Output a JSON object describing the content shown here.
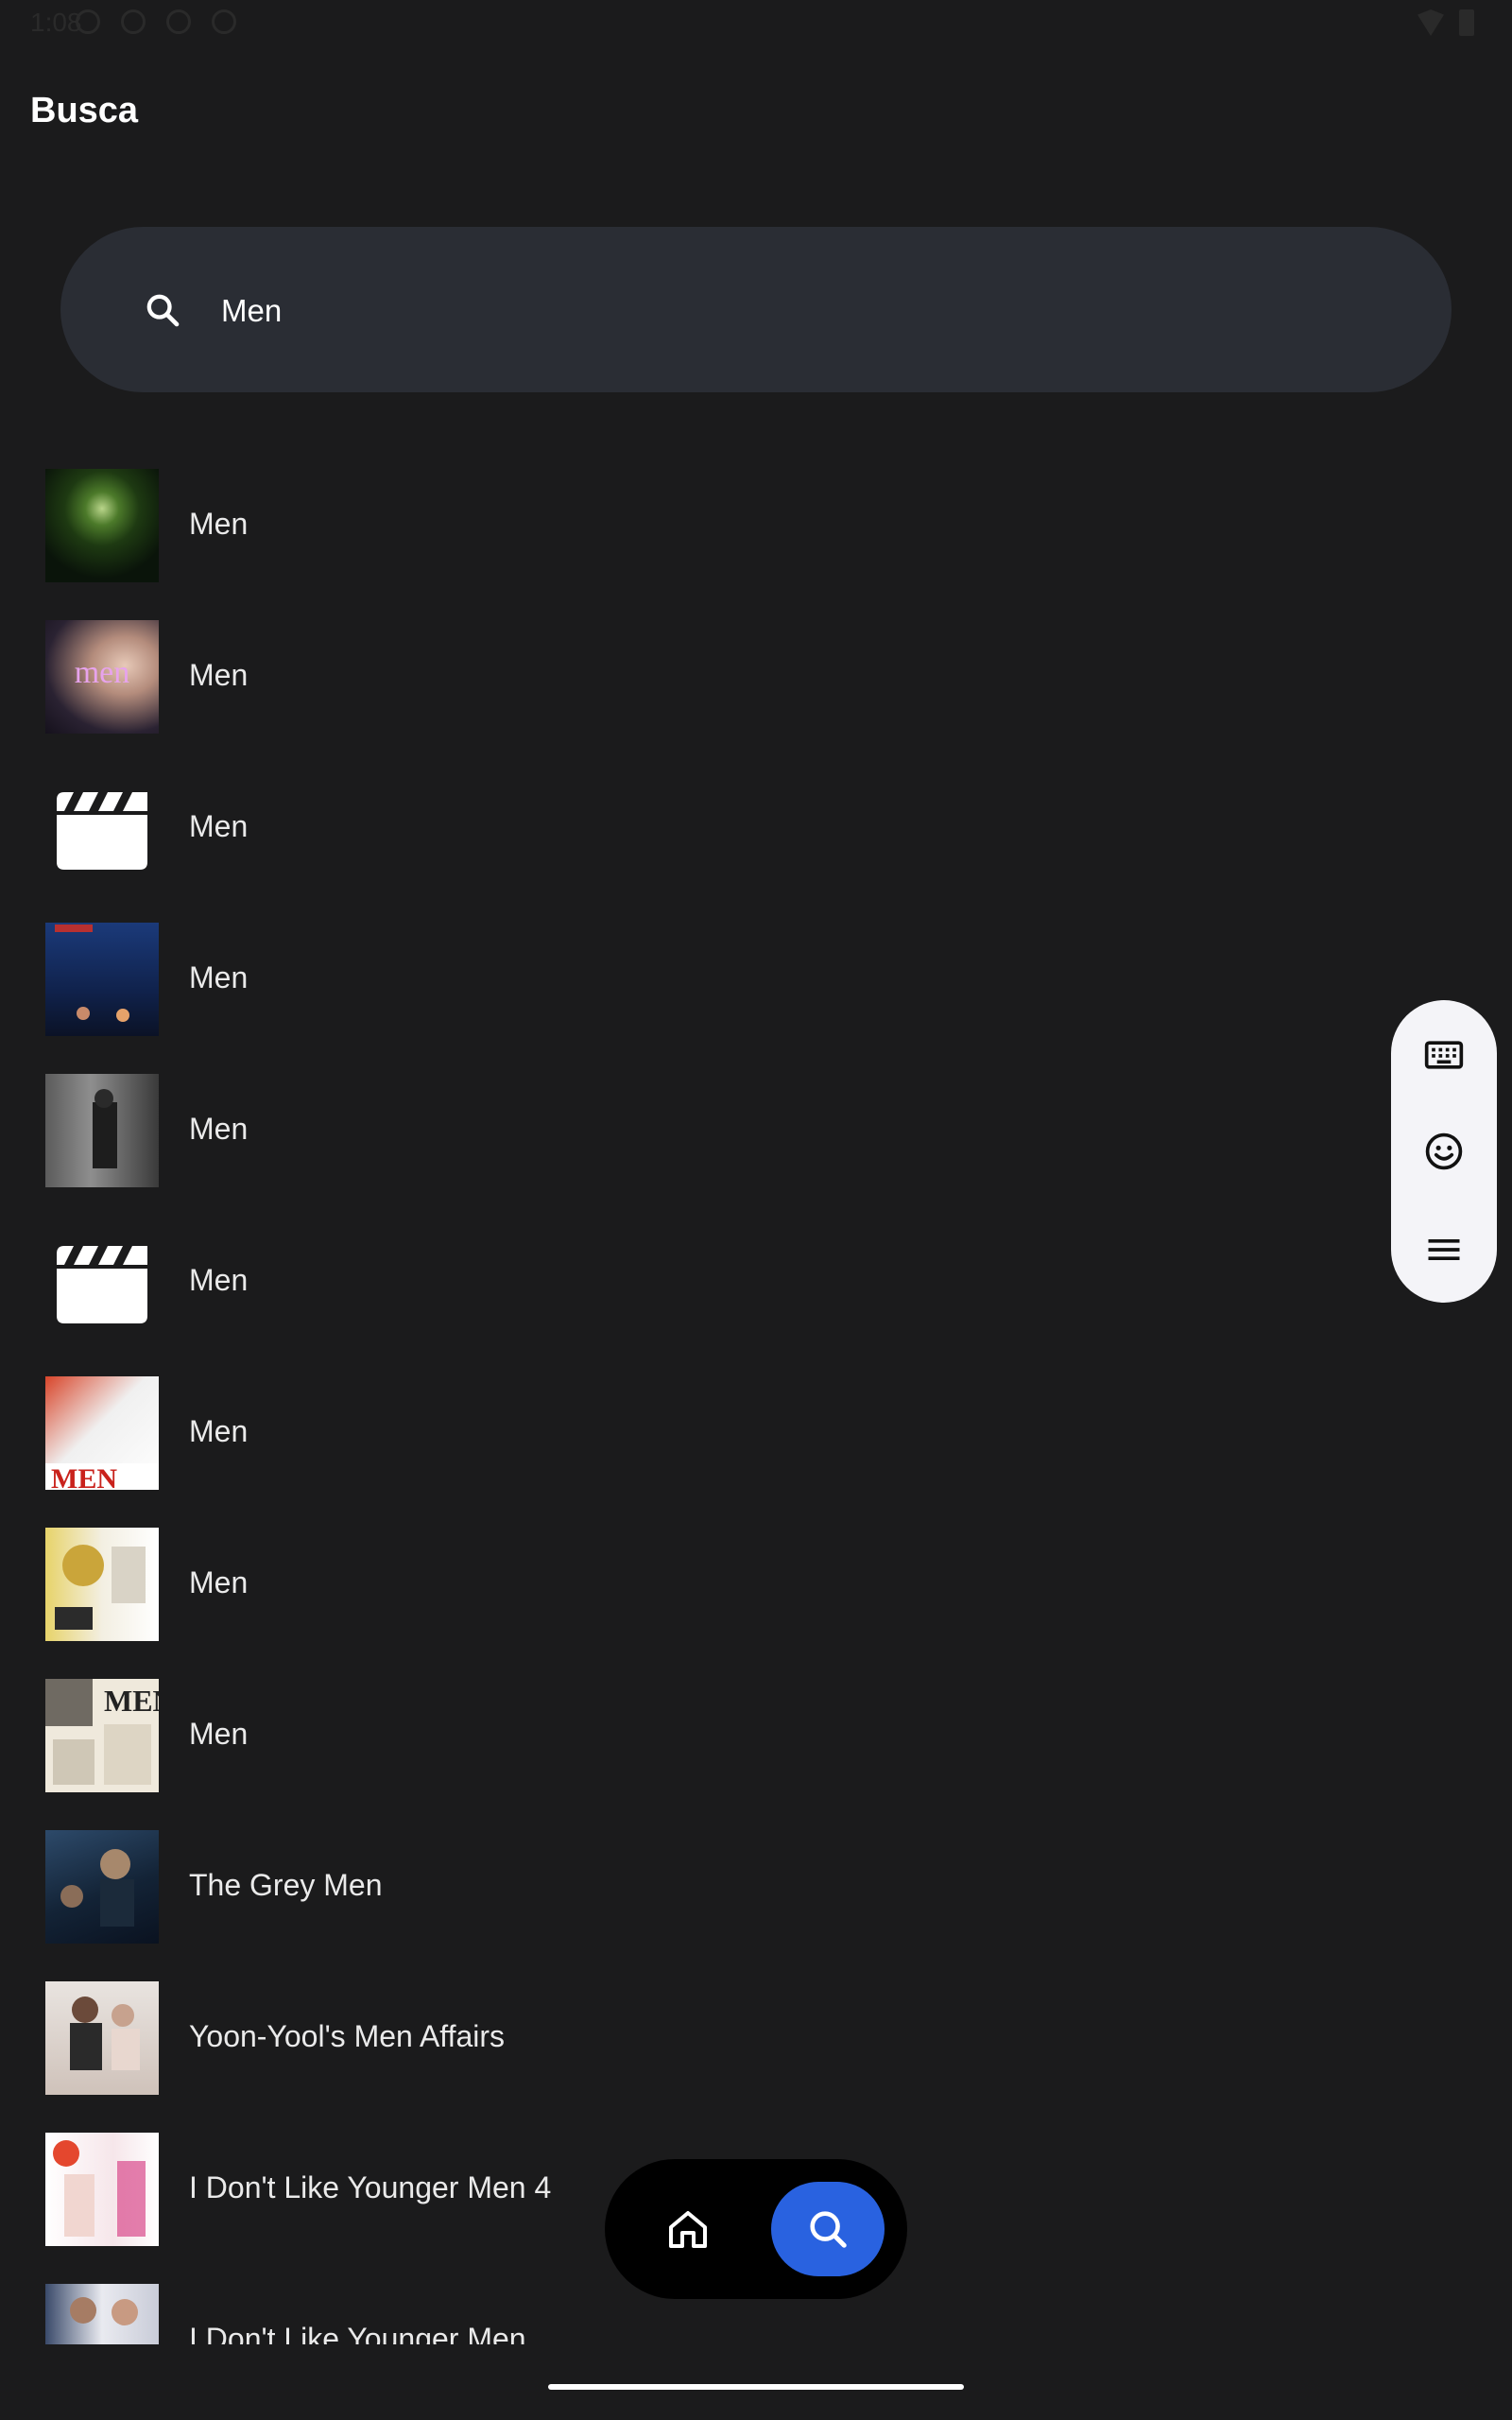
{
  "status": {
    "time": "1:08"
  },
  "header": {
    "title": "Busca"
  },
  "search": {
    "value": "Men",
    "placeholder": ""
  },
  "results": [
    {
      "title": "Men",
      "thumb": "forest-tunnel-poster"
    },
    {
      "title": "Men",
      "thumb": "mannequin-men-poster"
    },
    {
      "title": "Men",
      "thumb": "clapperboard-placeholder"
    },
    {
      "title": "Men",
      "thumb": "blue-night-poster"
    },
    {
      "title": "Men",
      "thumb": "grey-street-poster"
    },
    {
      "title": "Men",
      "thumb": "clapperboard-placeholder"
    },
    {
      "title": "Men",
      "thumb": "red-men-poster"
    },
    {
      "title": "Men",
      "thumb": "yellow-art-poster"
    },
    {
      "title": "Men",
      "thumb": "newspaper-men-poster"
    },
    {
      "title": "The Grey Men",
      "thumb": "dark-action-poster"
    },
    {
      "title": "Yoon-Yool's Men Affairs",
      "thumb": "korean-drama-poster"
    },
    {
      "title": "I Don't Like Younger Men 4",
      "thumb": "korean-pink-poster"
    },
    {
      "title": "I Don't Like Younger Men",
      "thumb": "korean-couple-poster"
    }
  ],
  "colors": {
    "background": "#1b1b1c",
    "search_bar": "#2a2d34",
    "accent": "#2962e0",
    "side_toolbar": "#f4f4f8",
    "nav_bg": "#000000"
  },
  "side_toolbar": {
    "icons": [
      "keyboard-icon",
      "emoji-icon",
      "menu-icon"
    ]
  },
  "bottom_nav": {
    "items": [
      "home-icon",
      "search-icon"
    ],
    "active": "search"
  }
}
